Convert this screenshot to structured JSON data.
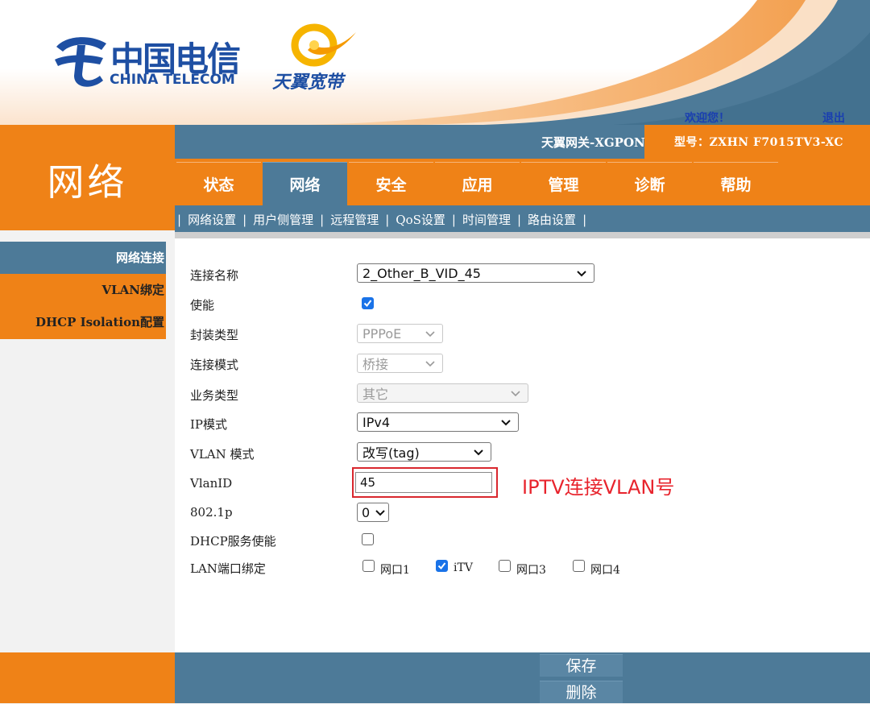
{
  "header": {
    "brand_cn": "中国电信",
    "brand_en": "CHINA TELECOM",
    "sub_brand": "天翼宽带",
    "welcome": "欢迎您！",
    "logout": "退出",
    "gateway_name": "天翼网关-XGPON",
    "model": "型号：ZXHN F7015TV3-XC",
    "colors": {
      "orange": "#ef8217",
      "steel_blue": "#4d7a98",
      "link_blue": "#1a3fb0"
    }
  },
  "section_title": "网络",
  "nav": {
    "tabs": [
      "状态",
      "网络",
      "安全",
      "应用",
      "管理",
      "诊断",
      "帮助"
    ],
    "active": "网络"
  },
  "subnav": {
    "items": [
      "网络设置",
      "用户侧管理",
      "远程管理",
      "QoS设置",
      "时间管理",
      "路由设置"
    ]
  },
  "sidebar": {
    "items": [
      "网络连接",
      "VLAN绑定",
      "DHCP Isolation配置"
    ],
    "active": "网络连接"
  },
  "form": {
    "connection_name": {
      "label": "连接名称",
      "value": "2_Other_B_VID_45"
    },
    "enable": {
      "label": "使能",
      "checked": true
    },
    "encapsulation": {
      "label": "封装类型",
      "value": "PPPoE",
      "disabled": true
    },
    "connection_mode": {
      "label": "连接模式",
      "value": "桥接",
      "disabled": true
    },
    "service_type": {
      "label": "业务类型",
      "value": "其它",
      "disabled": true
    },
    "ip_mode": {
      "label": "IP模式",
      "value": "IPv4"
    },
    "vlan_mode": {
      "label": "VLAN 模式",
      "value": "改写(tag)"
    },
    "vlan_id": {
      "label": "VlanID",
      "value": "45"
    },
    "dot1p": {
      "label": "802.1p",
      "value": "0"
    },
    "dhcp_service": {
      "label": "DHCP服务使能",
      "checked": false
    },
    "lan_binding": {
      "label": "LAN端口绑定",
      "ports": [
        {
          "name": "网口1",
          "checked": false
        },
        {
          "name": "iTV",
          "checked": true
        },
        {
          "name": "网口3",
          "checked": false
        },
        {
          "name": "网口4",
          "checked": false
        }
      ]
    }
  },
  "annotation": {
    "text": "IPTV连接VLAN号",
    "color": "#e8242d"
  },
  "footer": {
    "save": "保存",
    "delete": "删除"
  }
}
